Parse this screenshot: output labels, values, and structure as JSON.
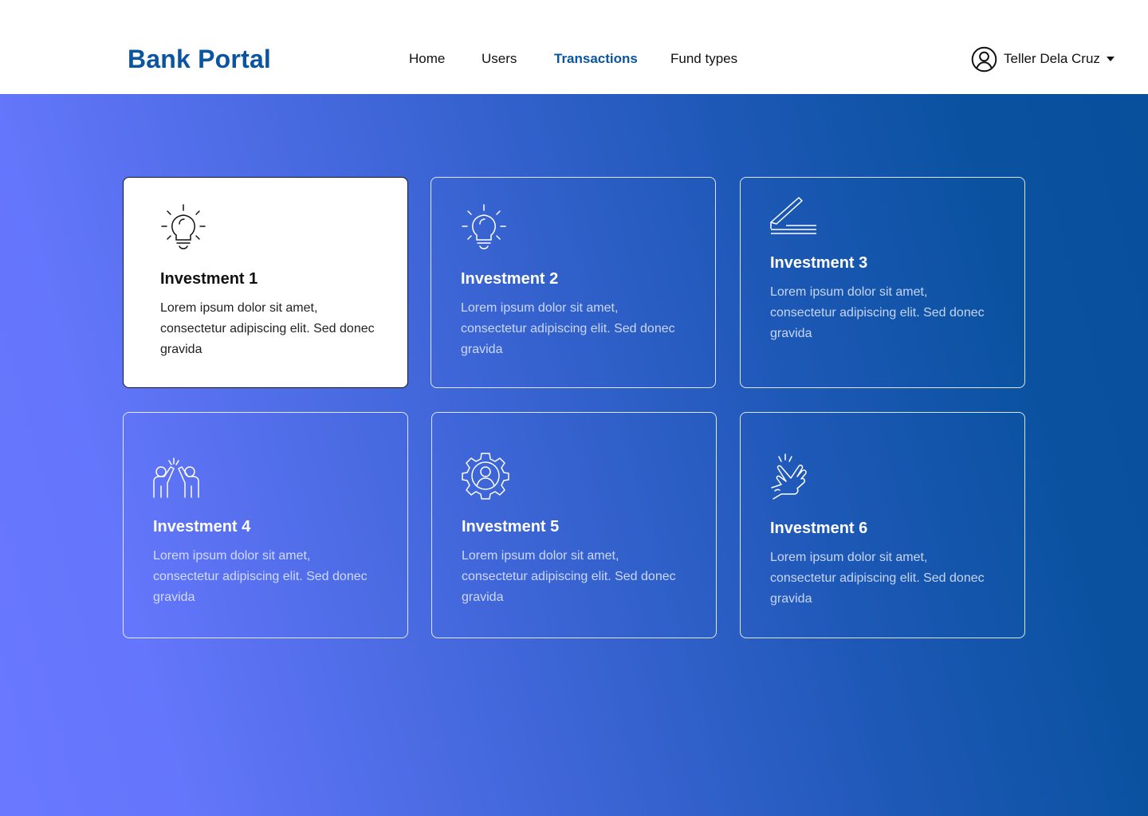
{
  "header": {
    "brand": "Bank Portal",
    "nav": [
      {
        "label": "Home",
        "active": false
      },
      {
        "label": "Users",
        "active": false
      },
      {
        "label": "Transactions",
        "active": true
      },
      {
        "label": "Fund types",
        "active": false
      }
    ],
    "user": {
      "name": "Teller Dela Cruz",
      "icon": "user-circle-icon",
      "menu_icon": "caret-down-icon"
    }
  },
  "colors": {
    "brand": "#0a55a0",
    "gradient_start": "#6a78ff",
    "gradient_end": "#08509c",
    "card_border": "#ffffff"
  },
  "cards": [
    {
      "title": "Investment 1",
      "description": "Lorem ipsum dolor sit amet, consectetur adipiscing elit. Sed donec gravida",
      "icon": "lightbulb-icon",
      "selected": true
    },
    {
      "title": "Investment 2",
      "description": "Lorem ipsum dolor sit amet, consectetur adipiscing elit. Sed donec gravida",
      "icon": "lightbulb-icon",
      "selected": false
    },
    {
      "title": "Investment 3",
      "description": "Lorem ipsum dolor sit amet, consectetur adipiscing elit. Sed donec gravida",
      "icon": "pen-line-icon",
      "selected": false
    },
    {
      "title": "Investment 4",
      "description": "Lorem ipsum dolor sit amet, consectetur adipiscing elit. Sed donec gravida",
      "icon": "high-five-icon",
      "selected": false
    },
    {
      "title": "Investment 5",
      "description": "Lorem ipsum dolor sit amet, consectetur adipiscing elit. Sed donec gravida",
      "icon": "gear-user-icon",
      "selected": false
    },
    {
      "title": "Investment 6",
      "description": "Lorem ipsum dolor sit amet, consectetur adipiscing elit. Sed donec gravida",
      "icon": "hand-tap-icon",
      "selected": false
    }
  ]
}
